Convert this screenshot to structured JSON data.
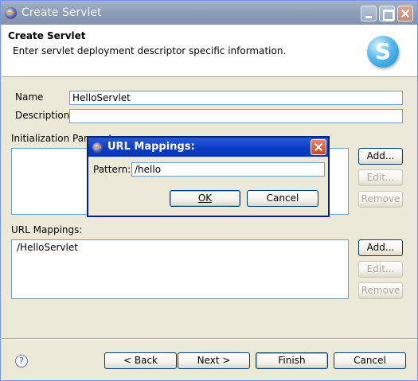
{
  "window": {
    "title": "Create Servlet"
  },
  "banner": {
    "title": "Create Servlet",
    "description": "Enter servlet deployment descriptor specific information.",
    "logo_letter": "S"
  },
  "form": {
    "name_label": "Name",
    "name_value": "HelloServlet",
    "description_label": "Description",
    "description_value": "",
    "init_params_label": "Initialization Parameters:",
    "url_mappings_label": "URL Mappings:",
    "url_mappings_items": [
      "/HelloServlet"
    ]
  },
  "side_buttons": {
    "add": "Add...",
    "edit": "Edit...",
    "remove": "Remove"
  },
  "footer": {
    "help_symbol": "?",
    "back": "< Back",
    "next": "Next >",
    "finish": "Finish",
    "cancel": "Cancel"
  },
  "dialog": {
    "title": "URL Mappings:",
    "pattern_label": "Pattern:",
    "pattern_value": "/hello",
    "ok": "OK",
    "cancel": "Cancel"
  }
}
